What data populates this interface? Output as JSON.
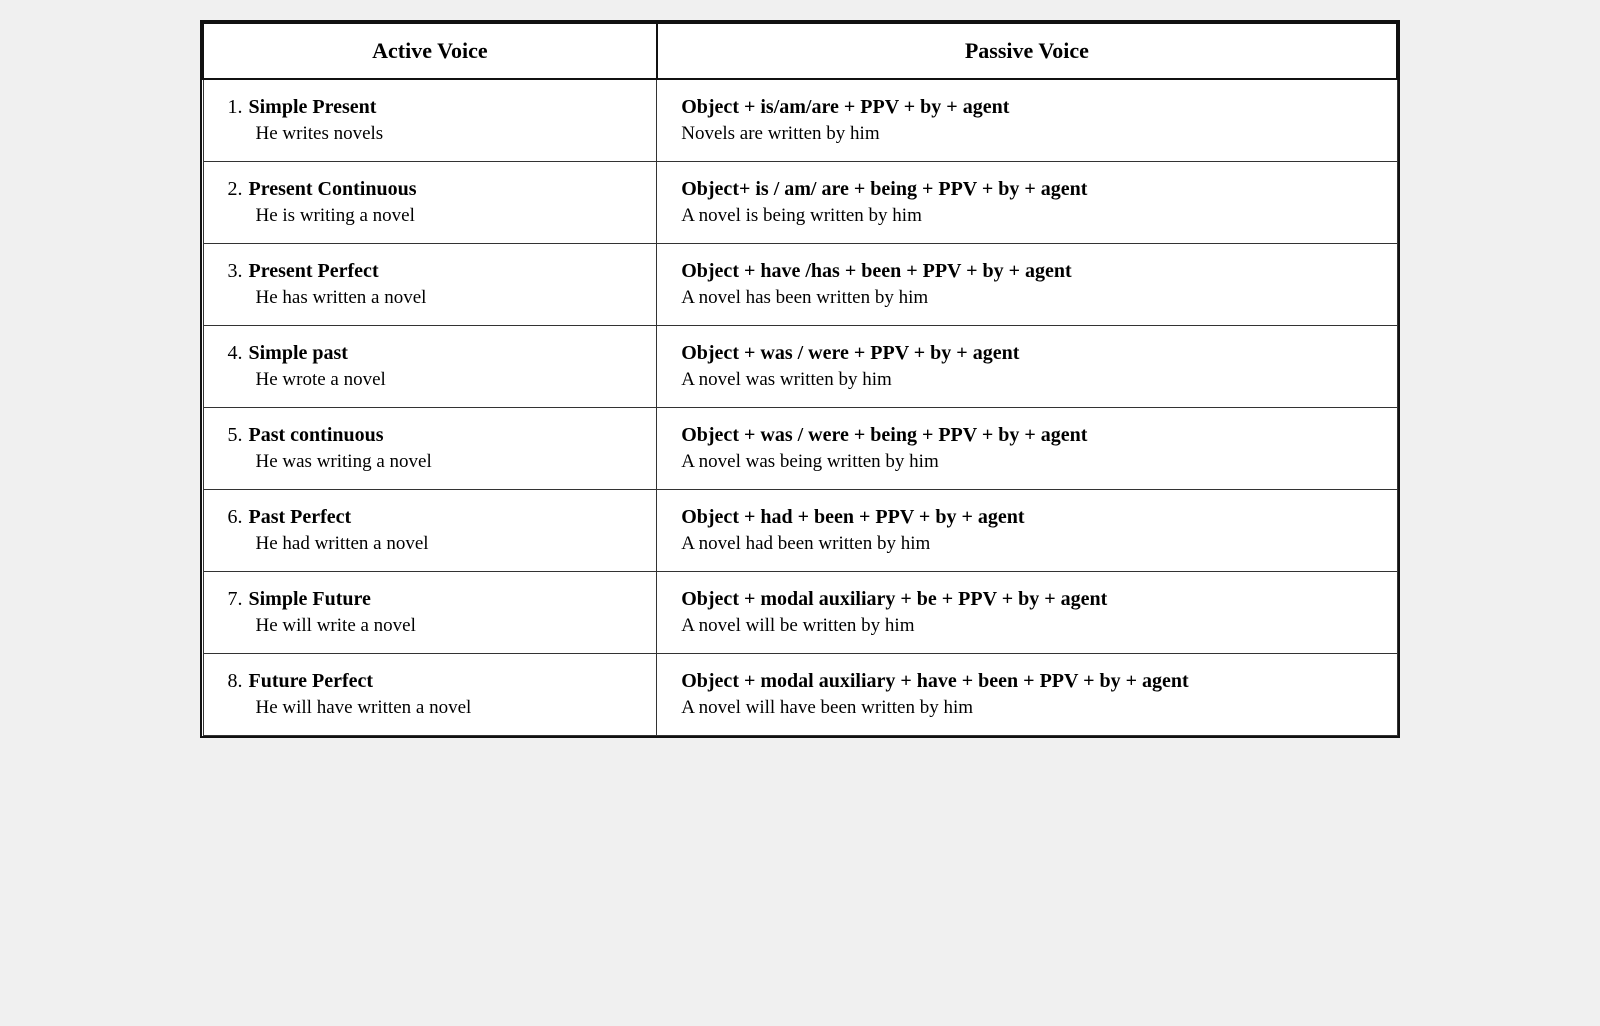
{
  "header": {
    "active_label": "Active Voice",
    "passive_label": "Passive Voice"
  },
  "rows": [
    {
      "number": "1.",
      "tense_name": "Simple Present",
      "active_example": "He writes novels",
      "passive_formula": "Object + is/am/are + PPV + by + agent",
      "passive_example": "Novels are written by him"
    },
    {
      "number": "2.",
      "tense_name": "Present Continuous",
      "active_example": "He is writing a novel",
      "passive_formula": "Object+ is / am/ are + being + PPV + by + agent",
      "passive_example": "A novel is being written by him"
    },
    {
      "number": "3.",
      "tense_name": "Present Perfect",
      "active_example": "He has written a novel",
      "passive_formula": "Object + have /has + been + PPV + by + agent",
      "passive_example": "A novel has been written by him"
    },
    {
      "number": "4.",
      "tense_name": "Simple past",
      "active_example": "He wrote a novel",
      "passive_formula": "Object + was / were + PPV + by + agent",
      "passive_example": "A novel was written by him"
    },
    {
      "number": "5.",
      "tense_name": "Past continuous",
      "active_example": "He was writing a novel",
      "passive_formula": "Object + was / were + being + PPV + by + agent",
      "passive_example": "A novel was  being written by him"
    },
    {
      "number": "6.",
      "tense_name": "Past Perfect",
      "active_example": "He had written a novel",
      "passive_formula": "Object + had + been + PPV + by + agent",
      "passive_example": "A novel had been written by him"
    },
    {
      "number": "7.",
      "tense_name": "Simple Future",
      "active_example": "He will write a novel",
      "passive_formula": "Object + modal auxiliary + be + PPV + by + agent",
      "passive_example": "A novel will be written by him"
    },
    {
      "number": "8.",
      "tense_name": "Future Perfect",
      "active_example": "He will have written a novel",
      "passive_formula": "Object + modal auxiliary +  have + been + PPV + by + agent",
      "passive_example": "A novel will have been written by him"
    }
  ]
}
